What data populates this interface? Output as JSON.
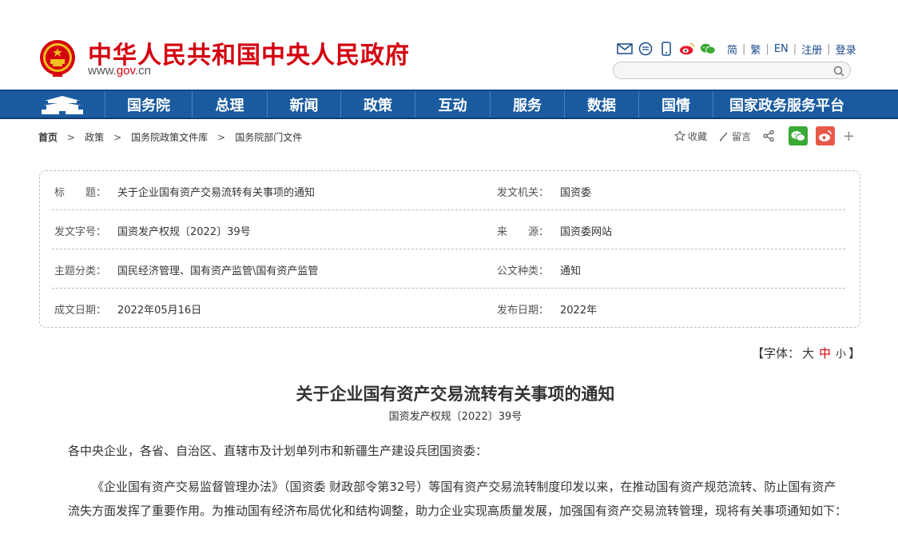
{
  "header": {
    "site_title": "中华人民共和国中央人民政府",
    "site_url_prefix": "www.",
    "site_url_gov": "gov",
    "site_url_suffix": ".cn",
    "tools": [
      "email-icon",
      "message-icon",
      "mobile-icon",
      "weibo-icon",
      "wechat-icon"
    ],
    "lang": {
      "simplified": "简",
      "traditional": "繁",
      "english": "EN",
      "register": "注册",
      "login": "登录"
    },
    "search": {
      "placeholder": ""
    }
  },
  "nav": {
    "items": [
      "国务院",
      "总理",
      "新闻",
      "政策",
      "互动",
      "服务",
      "数据",
      "国情",
      "国家政务服务平台"
    ],
    "bg_color": "#1a5ba0"
  },
  "breadcrumb": [
    "首页",
    "政策",
    "国务院政策文件库",
    "国务院部门文件"
  ],
  "share": {
    "favorite": "收藏",
    "comment": "留言",
    "more": "+"
  },
  "info": {
    "title_label": "标　　题：",
    "title_value": "关于企业国有资产交易流转有关事项的通知",
    "issuer_label": "发文机关：",
    "issuer_value": "国资委",
    "docno_label": "发文字号：",
    "docno_value": "国资发产权规〔2022〕39号",
    "source_label": "来　　源：",
    "source_value": "国资委网站",
    "topic_label": "主题分类：",
    "topic_value": "国民经济管理、国有资产监管\\国有资产监管",
    "type_label": "公文种类：",
    "type_value": "通知",
    "date_label": "成文日期：",
    "date_value": "2022年05月16日",
    "pub_label": "发布日期：",
    "pub_value": "2022年"
  },
  "font_size": {
    "prefix": "【字体：",
    "large": "大",
    "medium": "中",
    "small": "小",
    "suffix": "】"
  },
  "article": {
    "title": "关于企业国有资产交易流转有关事项的通知",
    "doc_number": "国资发产权规〔2022〕39号",
    "para1": "各中央企业，各省、自治区、直辖市及计划单列市和新疆生产建设兵团国资委：",
    "para2": "《企业国有资产交易监督管理办法》（国资委 财政部令第32号）等国有资产交易流转制度印发以来，在推动国有资产规范流转、防止国有资产流失方面发挥了重要作用。为推动国有经济布局优化和结构调整，助力企业实现高质量发展，加强国有资产交易流转管理，现将有关事项通知如下："
  },
  "colors": {
    "brand_red": "#d4000f",
    "link_blue": "#1a4a8a"
  }
}
